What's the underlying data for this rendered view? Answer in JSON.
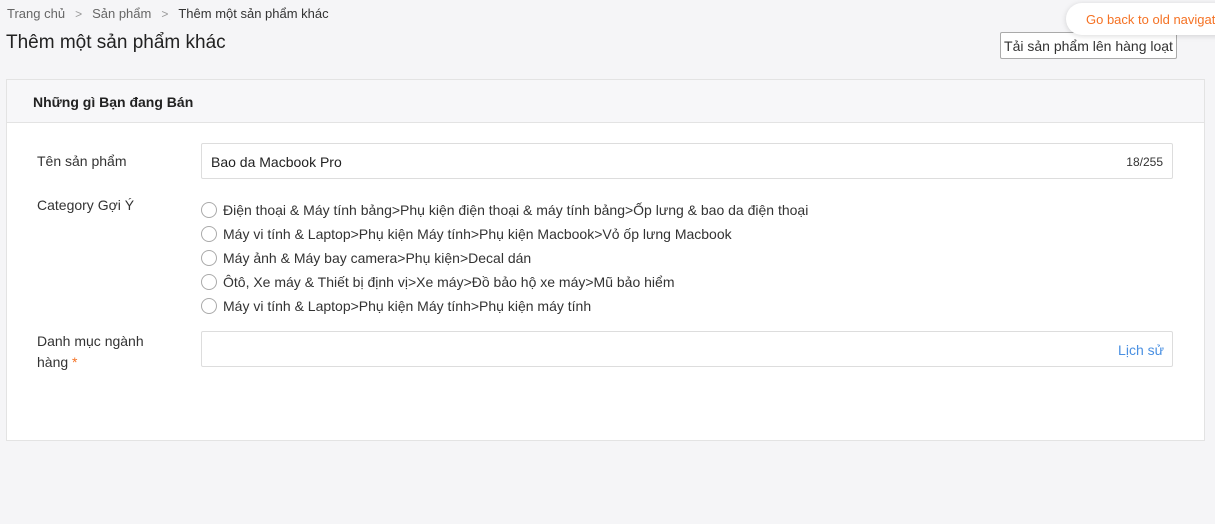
{
  "breadcrumb": {
    "home": "Trang chủ",
    "products": "Sản phẩm",
    "current": "Thêm một sản phẩm khác"
  },
  "page_title": "Thêm một sản phẩm khác",
  "old_nav_label": "Go back to old navigation",
  "bulk_upload_label": "Tải sản phẩm lên hàng loạt",
  "section_title": "Những gì Bạn đang Bán",
  "product_name": {
    "label": "Tên sản phẩm",
    "value": "Bao da Macbook Pro",
    "counter": "18/255"
  },
  "category_suggest": {
    "label": "Category Gợi Ý",
    "options": [
      "Điện thoại & Máy tính bảng>Phụ kiện điện thoại & máy tính bảng>Ốp lưng & bao da điện thoại",
      "Máy vi tính & Laptop>Phụ kiện Máy tính>Phụ kiện Macbook>Vỏ ốp lưng Macbook",
      "Máy ảnh & Máy bay camera>Phụ kiện>Decal dán",
      "Ôtô, Xe máy & Thiết bị định vị>Xe máy>Đồ bảo hộ xe máy>Mũ bảo hiểm",
      "Máy vi tính & Laptop>Phụ kiện Máy tính>Phụ kiện máy tính"
    ]
  },
  "category_field": {
    "label_line1": "Danh mục ngành",
    "label_line2": "hàng",
    "required_mark": "*",
    "history_link": "Lịch sử"
  },
  "colors": {
    "accent": "#f57224",
    "link": "#4a90e2"
  }
}
